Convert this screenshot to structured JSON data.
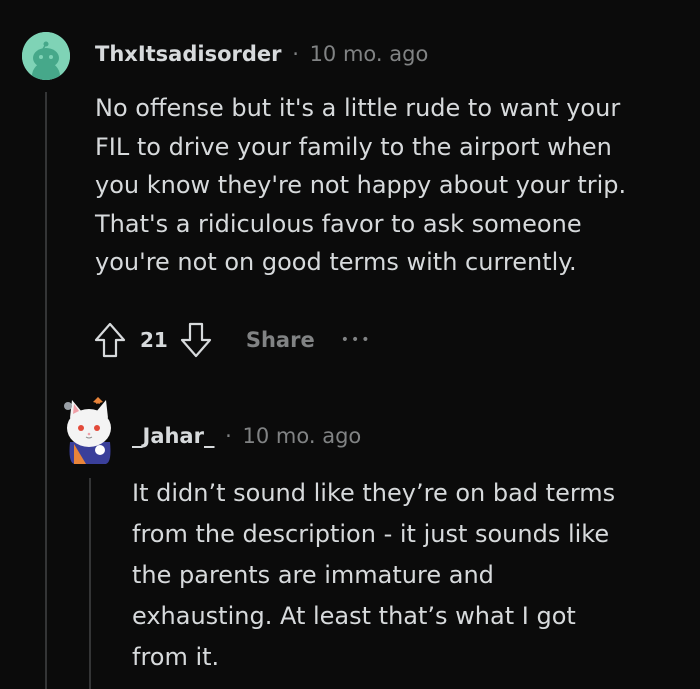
{
  "comments": [
    {
      "username": "ThxItsadisorder",
      "separator": "·",
      "time": "10 mo. ago",
      "body_lines": [
        "No offense but it's a little rude to want your",
        "FIL to drive your family to the airport when",
        "you know they're not happy about your trip.",
        "That's a ridiculous favor to ask someone",
        "you're not on good terms with currently."
      ],
      "score": "21",
      "share_label": "Share",
      "more_label": "•••",
      "avatar_icon": "snoo-avatar-icon",
      "avatar_color": "#7fd3b6"
    },
    {
      "username": "_Jahar_",
      "separator": "·",
      "time": "10 mo. ago",
      "body_lines": [
        "It didn’t sound like they’re on bad terms",
        "from the description - it just sounds like",
        "the parents are immature and",
        "exhausting. At least that’s what I got",
        "from it."
      ],
      "avatar_icon": "cat-avatar-icon"
    }
  ],
  "colors": {
    "background": "#0b0b0b",
    "text": "#d7dadc",
    "muted": "#818384",
    "thread_line": "#343536"
  }
}
